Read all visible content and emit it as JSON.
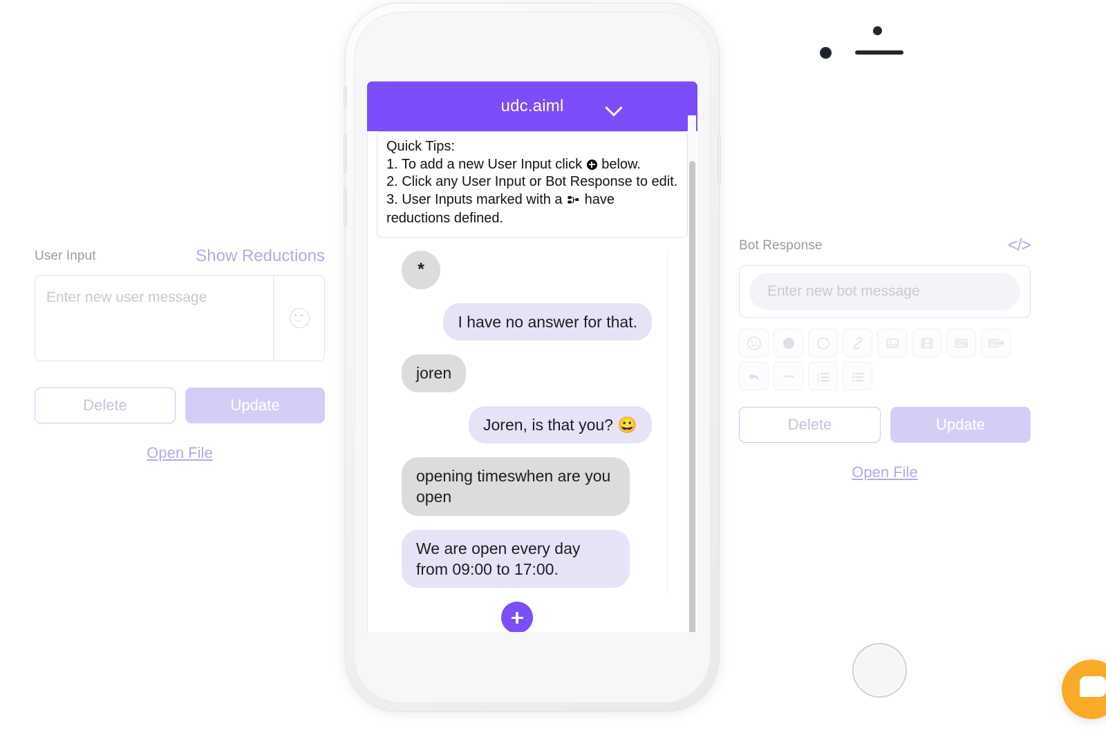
{
  "left_panel": {
    "label": "User Input",
    "show_reductions": "Show Reductions",
    "textarea_placeholder": "Enter new user message",
    "textarea_value": "",
    "emoji_icon": "smiley-icon",
    "delete_label": "Delete",
    "update_label": "Update",
    "open_file_label": "Open File"
  },
  "right_panel": {
    "label": "Bot Response",
    "code_icon_label": "</>",
    "input_placeholder": "Enter new bot message",
    "input_value": "",
    "delete_label": "Delete",
    "update_label": "Update",
    "open_file_label": "Open File",
    "toolbar_row1": [
      {
        "name": "emoji-icon"
      },
      {
        "name": "filled-circle-icon"
      },
      {
        "name": "outline-circle-icon"
      },
      {
        "name": "link-icon"
      },
      {
        "name": "image-icon"
      },
      {
        "name": "video-icon"
      },
      {
        "name": "card-icon"
      },
      {
        "name": "card-add-icon"
      }
    ],
    "toolbar_row2": [
      {
        "name": "reply-icon"
      },
      {
        "name": "ellipsis-icon"
      },
      {
        "name": "ordered-list-icon"
      },
      {
        "name": "bullet-list-icon"
      }
    ]
  },
  "phone": {
    "header_title": "udc.aiml",
    "header_chevron": "chevron-down-icon",
    "tips": {
      "title": "Quick Tips:",
      "line1_before": "1. To add a new User Input click ",
      "line1_after": " below.",
      "line2": "2. Click any User Input or Bot Response to edit.",
      "line3_before": "3. User Inputs marked with a ",
      "line3_after": " have reductions defined."
    },
    "messages": [
      {
        "side": "left",
        "kind": "star",
        "text": "*"
      },
      {
        "side": "right",
        "kind": "bot",
        "text": "I have no answer for that."
      },
      {
        "side": "left",
        "kind": "user",
        "text": "joren"
      },
      {
        "side": "right",
        "kind": "bot",
        "text": "Joren, is that you? 😀"
      },
      {
        "side": "left",
        "kind": "user",
        "text": "opening timeswhen are you open"
      },
      {
        "side": "left",
        "kind": "bot",
        "text": "We are open every day from 09:00 to 17:00."
      }
    ],
    "add_button": "add-message-button"
  },
  "help_widget": {
    "name": "help-chat-widget"
  },
  "colors": {
    "brand_purple": "#7c4dfa",
    "soft_purple": "#b3a9e8",
    "update_fill": "#d6cdf7",
    "bot_bubble": "#e6e3f7",
    "user_bubble": "#dcdcdc",
    "help_orange": "#f9ab27"
  }
}
